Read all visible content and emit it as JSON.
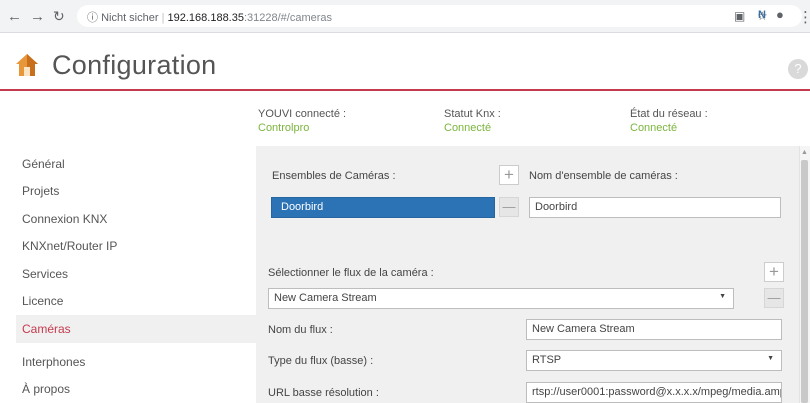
{
  "browser": {
    "security_label": "Nicht sicher",
    "url_host": "192.168.188.35",
    "url_rest": ":31228/#/cameras"
  },
  "app": {
    "title": "Configuration",
    "help": "?"
  },
  "status": [
    {
      "label": "YOUVI connecté :",
      "value": "Controlpro"
    },
    {
      "label": "Statut Knx :",
      "value": "Connecté"
    },
    {
      "label": "État du réseau :",
      "value": "Connecté"
    }
  ],
  "sidebar": {
    "items": [
      {
        "label": "Général"
      },
      {
        "label": "Projets"
      },
      {
        "label": "Connexion KNX"
      },
      {
        "label": "KNXnet/Router IP"
      },
      {
        "label": "Services"
      },
      {
        "label": "Licence"
      },
      {
        "label": "Caméras"
      },
      {
        "label": "Interphones"
      },
      {
        "label": "À propos"
      }
    ],
    "active_index": 6
  },
  "cameras": {
    "sets_label": "Ensembles de Caméras :",
    "sets": [
      "Doorbird"
    ],
    "set_name_label": "Nom d'ensemble de caméras :",
    "set_name_value": "Doorbird",
    "stream_select_label": "Sélectionner le flux de la caméra :",
    "stream_selected": "New Camera Stream",
    "stream_name_label": "Nom du flux :",
    "stream_name_value": "New Camera Stream",
    "stream_type_label": "Type du flux (basse) :",
    "stream_type_value": "RTSP",
    "url_low_label": "URL basse résolution :",
    "url_low_value": "rtsp://user0001:password@x.x.x.x/mpeg/media.amp",
    "add_symbol": "+",
    "remove_symbol": "—"
  },
  "colors": {
    "accent": "#c53a4e",
    "selected_item": "#2b73b4",
    "connected": "#7bb53c",
    "panel_bg": "#f0f0f0"
  },
  "icons": [
    "back-icon",
    "forward-icon",
    "reload-icon",
    "info-icon",
    "translate-icon",
    "star-icon",
    "extension-icon",
    "profile-icon",
    "menu-icon",
    "house-logo-icon",
    "help-icon",
    "plus-icon",
    "minus-icon",
    "dropdown-caret-icon"
  ]
}
